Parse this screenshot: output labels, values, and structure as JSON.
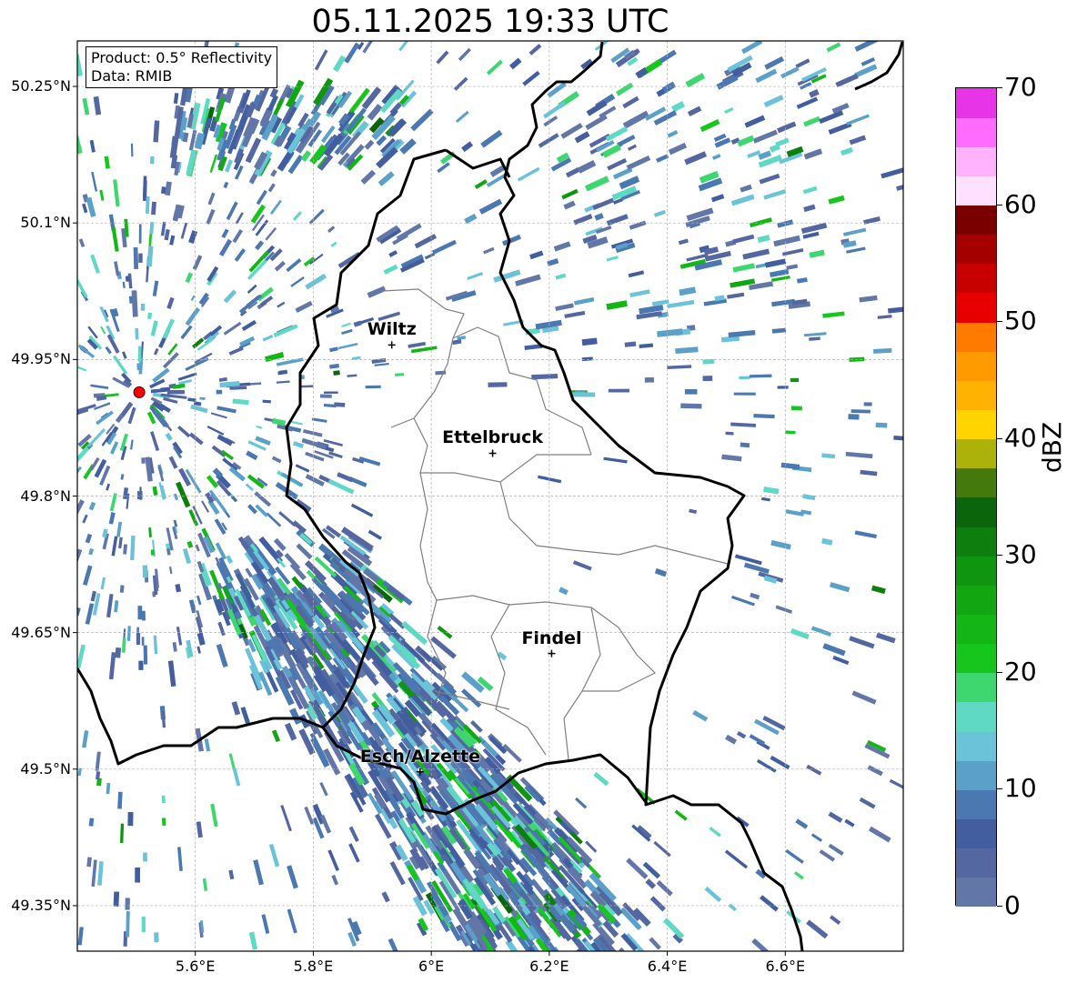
{
  "title": "05.11.2025 19:33 UTC",
  "info": {
    "product": "Product: 0.5° Reflectivity",
    "data": "Data: RMIB"
  },
  "lat_ticks": [
    "50.25°N",
    "50.1°N",
    "49.95°N",
    "49.8°N",
    "49.65°N",
    "49.5°N",
    "49.35°N"
  ],
  "lat_values": [
    50.25,
    50.1,
    49.95,
    49.8,
    49.65,
    49.5,
    49.35
  ],
  "lon_ticks": [
    "5.6°E",
    "5.8°E",
    "6°E",
    "6.2°E",
    "6.4°E",
    "6.6°E"
  ],
  "lon_values": [
    5.6,
    5.8,
    6.0,
    6.2,
    6.4,
    6.6
  ],
  "extent": {
    "lon": [
      5.4,
      6.8
    ],
    "lat": [
      49.3,
      50.3
    ]
  },
  "cities": [
    {
      "name": "Wiltz",
      "lon": 5.933,
      "lat": 49.966
    },
    {
      "name": "Ettelbruck",
      "lon": 6.104,
      "lat": 49.847
    },
    {
      "name": "Findel",
      "lon": 6.204,
      "lat": 49.627
    },
    {
      "name": "Esch/Alzette",
      "lon": 5.981,
      "lat": 49.497
    }
  ],
  "radar_site": {
    "lon": 5.505,
    "lat": 49.914
  },
  "colorbar": {
    "label": "dBZ",
    "min": 0,
    "max": 70,
    "ticks": [
      "0",
      "10",
      "20",
      "30",
      "40",
      "50",
      "60",
      "70"
    ],
    "tick_values": [
      0,
      10,
      20,
      30,
      40,
      50,
      60,
      70
    ],
    "colors": [
      "#6276a8",
      "#5467a0",
      "#435e9f",
      "#4b78b0",
      "#5aa0c8",
      "#6bc3da",
      "#5fd9c4",
      "#3ed66e",
      "#16c61c",
      "#14b616",
      "#12a612",
      "#109510",
      "#0e7e0e",
      "#0b650b",
      "#447a0c",
      "#adb20a",
      "#ffd400",
      "#ffb300",
      "#ff9a00",
      "#ff7b00",
      "#e60000",
      "#c70000",
      "#a40000",
      "#7a0000",
      "#ffe0ff",
      "#ffb3ff",
      "#ff6cff",
      "#e634e6"
    ]
  },
  "colors": {
    "border": "#000000",
    "cantons": "#808080",
    "grid": "#b0b0b0",
    "radar_site": "#ff0000"
  }
}
